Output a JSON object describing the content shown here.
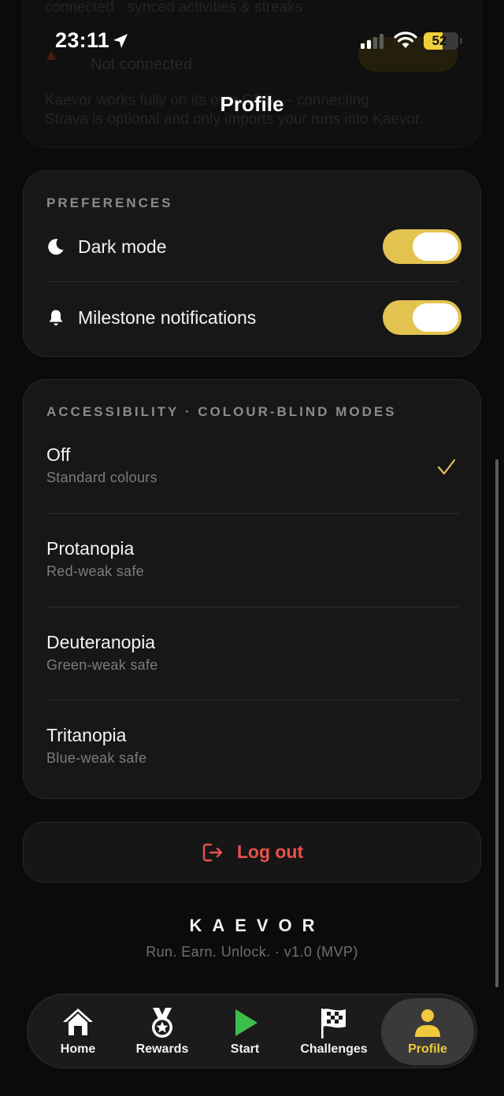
{
  "status_bar": {
    "time": "23:11",
    "battery": "52"
  },
  "header": {
    "title": "Profile"
  },
  "background_card": {
    "line1": "connected · synced activities & streaks",
    "status": "Not connected",
    "desc1": "Kaevor works fully on its own GPS — connecting",
    "desc2": "Strava is optional and only imports your runs into Kaevor."
  },
  "preferences": {
    "section_label": "PREFERENCES",
    "items": [
      {
        "label": "Dark mode",
        "icon": "moon-icon",
        "enabled": true
      },
      {
        "label": "Milestone notifications",
        "icon": "bell-icon",
        "enabled": true
      }
    ]
  },
  "accessibility": {
    "section_label": "ACCESSIBILITY · COLOUR-BLIND MODES",
    "options": [
      {
        "title": "Off",
        "subtitle": "Standard colours",
        "selected": true
      },
      {
        "title": "Protanopia",
        "subtitle": "Red-weak safe",
        "selected": false
      },
      {
        "title": "Deuteranopia",
        "subtitle": "Green-weak safe",
        "selected": false
      },
      {
        "title": "Tritanopia",
        "subtitle": "Blue-weak safe",
        "selected": false
      }
    ]
  },
  "logout": {
    "label": "Log out",
    "icon": "logout-icon",
    "color": "#e8524a"
  },
  "footer": {
    "brand": "KAEVOR",
    "tagline": "Run. Earn. Unlock.   ·   v1.0 (MVP)"
  },
  "tabs": [
    {
      "label": "Home",
      "icon": "home-icon"
    },
    {
      "label": "Rewards",
      "icon": "medal-icon"
    },
    {
      "label": "Start",
      "icon": "play-icon"
    },
    {
      "label": "Challenges",
      "icon": "checkered-flag-icon"
    },
    {
      "label": "Profile",
      "icon": "person-icon",
      "active": true
    }
  ],
  "colors": {
    "accent": "#e3c350",
    "active_tab_text": "#f0c93e",
    "start_green": "#3bbf4a",
    "danger": "#e8524a"
  }
}
